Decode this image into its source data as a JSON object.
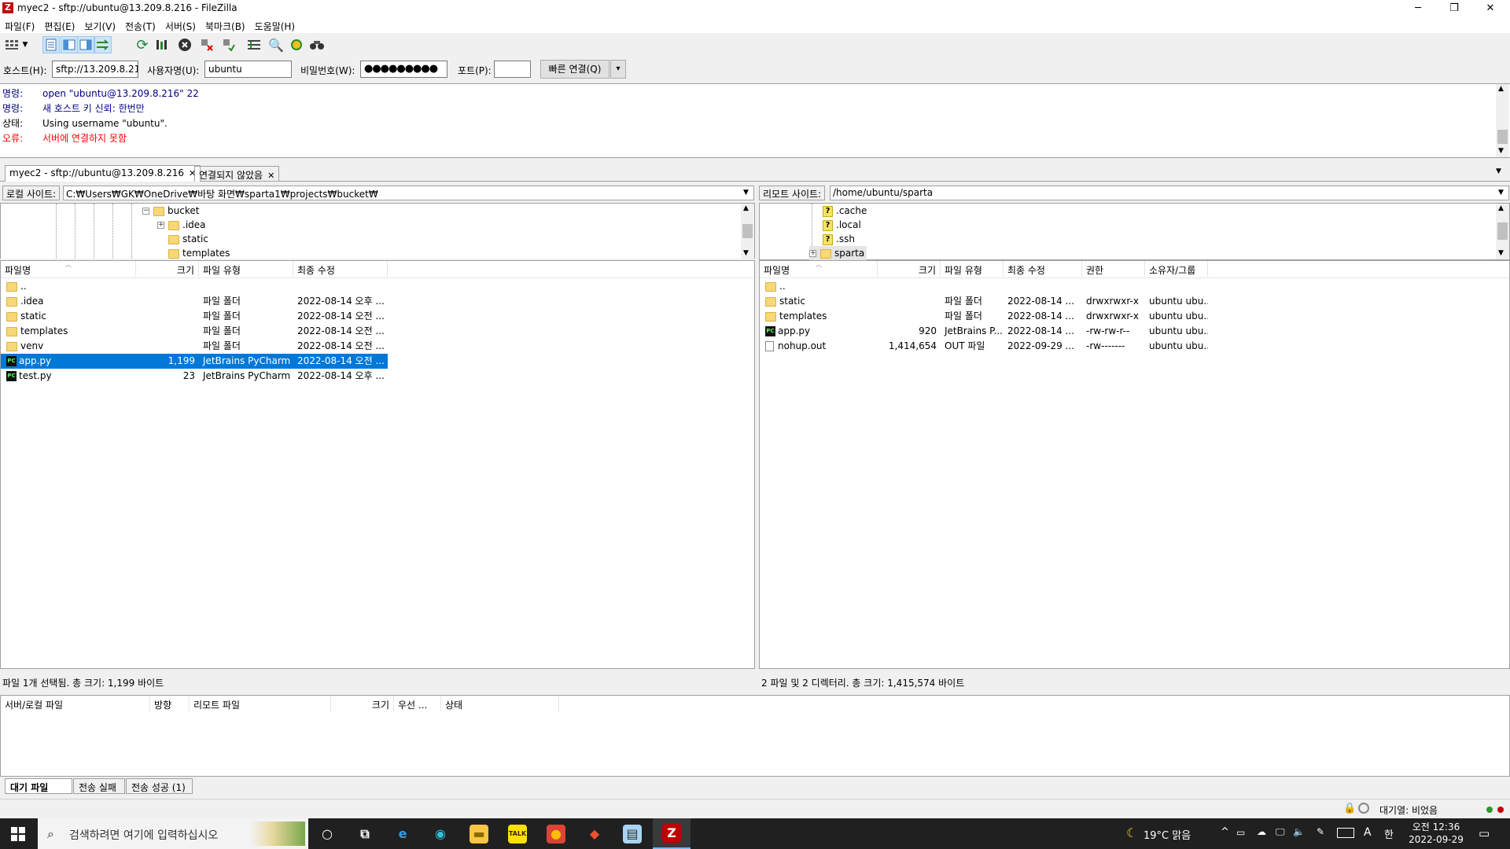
{
  "window": {
    "title": "myec2 - sftp://ubuntu@13.209.8.216 - FileZilla",
    "app_icon": "Z",
    "controls": {
      "minimize": "─",
      "maximize": "❐",
      "close": "✕"
    }
  },
  "menu": [
    "파일(F)",
    "편집(E)",
    "보기(V)",
    "전송(T)",
    "서버(S)",
    "북마크(B)",
    "도움말(H)"
  ],
  "toolbar": {
    "icons": [
      "site-manager-icon",
      "dropdown-arrow-icon",
      "toggle-log-icon",
      "toggle-local-tree-icon",
      "toggle-remote-tree-icon",
      "toggle-queue-icon",
      "refresh-icon",
      "process-queue-icon",
      "cancel-icon",
      "disconnect-icon",
      "reconnect-icon",
      "filter-icon",
      "compare-icon",
      "sync-browse-icon",
      "search-icon"
    ]
  },
  "quickconnect": {
    "host_label": "호스트(H):",
    "host_value": "sftp://13.209.8.216",
    "user_label": "사용자명(U):",
    "user_value": "ubuntu",
    "password_label": "비밀번호(W):",
    "password_value": "●●●●●●●●●",
    "port_label": "포트(P):",
    "port_value": "",
    "connect_button": "빠른 연결(Q)",
    "dropdown": "▾"
  },
  "log": [
    {
      "kind": "명령:",
      "text": "open \"ubuntu@13.209.8.216\" 22",
      "color": "#000080"
    },
    {
      "kind": "명령:",
      "text": "새 호스트 키 신뢰: 한번만",
      "color": "#000080"
    },
    {
      "kind": "상태:",
      "text": "Using username \"ubuntu\".",
      "color": "#000000"
    },
    {
      "kind": "오류:",
      "text": "서버에 연결하지 못함",
      "color": "#ff0000"
    }
  ],
  "tabs": [
    {
      "label": "myec2 - sftp://ubuntu@13.209.8.216",
      "close": "✕"
    },
    {
      "label": "연결되지 않았음",
      "close": "✕"
    }
  ],
  "local": {
    "site_label": "로컬 사이트:",
    "path": "C:₩Users₩GK₩OneDrive₩바탕 화면₩sparta1₩projects₩bucket₩",
    "tree": [
      {
        "name": "bucket",
        "expander": "−"
      },
      {
        "name": ".idea",
        "expander": "+"
      },
      {
        "name": "static",
        "expander": ""
      },
      {
        "name": "templates",
        "expander": ""
      }
    ],
    "columns": [
      "파일명",
      "크기",
      "파일 유형",
      "최종 수정"
    ],
    "files": [
      {
        "name": "..",
        "size": "",
        "type": "",
        "modified": "",
        "icon": "folder"
      },
      {
        "name": ".idea",
        "size": "",
        "type": "파일 폴더",
        "modified": "2022-08-14 오후 ...",
        "icon": "folder"
      },
      {
        "name": "static",
        "size": "",
        "type": "파일 폴더",
        "modified": "2022-08-14 오전 ...",
        "icon": "folder"
      },
      {
        "name": "templates",
        "size": "",
        "type": "파일 폴더",
        "modified": "2022-08-14 오전 ...",
        "icon": "folder"
      },
      {
        "name": "venv",
        "size": "",
        "type": "파일 폴더",
        "modified": "2022-08-14 오전 ...",
        "icon": "folder"
      },
      {
        "name": "app.py",
        "size": "1,199",
        "type": "JetBrains PyCharm",
        "modified": "2022-08-14 오전 ...",
        "icon": "pycharm",
        "selected": true
      },
      {
        "name": "test.py",
        "size": "23",
        "type": "JetBrains PyCharm",
        "modified": "2022-08-14 오후 ...",
        "icon": "pycharm"
      }
    ],
    "status": "파일 1개 선택됨. 총 크기: 1,199 바이트"
  },
  "remote": {
    "site_label": "리모트 사이트:",
    "path": "/home/ubuntu/sparta",
    "tree": [
      {
        "name": ".cache",
        "icon": "unknown"
      },
      {
        "name": ".local",
        "icon": "unknown"
      },
      {
        "name": ".ssh",
        "icon": "unknown"
      },
      {
        "name": "sparta",
        "icon": "folder",
        "expander": "+"
      }
    ],
    "columns": [
      "파일명",
      "크기",
      "파일 유형",
      "최종 수정",
      "권한",
      "소유자/그룹"
    ],
    "files": [
      {
        "name": "..",
        "size": "",
        "type": "",
        "modified": "",
        "perm": "",
        "owner": "",
        "icon": "folder"
      },
      {
        "name": "static",
        "size": "",
        "type": "파일 폴더",
        "modified": "2022-08-14 ...",
        "perm": "drwxrwxr-x",
        "owner": "ubuntu ubu...",
        "icon": "folder"
      },
      {
        "name": "templates",
        "size": "",
        "type": "파일 폴더",
        "modified": "2022-08-14 ...",
        "perm": "drwxrwxr-x",
        "owner": "ubuntu ubu...",
        "icon": "folder"
      },
      {
        "name": "app.py",
        "size": "920",
        "type": "JetBrains P...",
        "modified": "2022-08-14 ...",
        "perm": "-rw-rw-r--",
        "owner": "ubuntu ubu...",
        "icon": "pycharm"
      },
      {
        "name": "nohup.out",
        "size": "1,414,654",
        "type": "OUT 파일",
        "modified": "2022-09-29 ...",
        "perm": "-rw-------",
        "owner": "ubuntu ubu...",
        "icon": "file"
      }
    ],
    "status": "2 파일 및 2 디렉터리. 총 크기: 1,415,574 바이트"
  },
  "queue": {
    "columns": [
      "서버/로컬 파일",
      "방향",
      "리모트 파일",
      "크기",
      "우선 ...",
      "상태"
    ],
    "tabs": [
      "대기 파일",
      "전송 실패",
      "전송 성공 (1)"
    ]
  },
  "statusbar": {
    "queue": "대기열: 비었음"
  },
  "taskbar": {
    "search_placeholder": "검색하려면 여기에 입력하십시오",
    "weather": "19°C 맑음",
    "ime": "A",
    "ime2": "한",
    "time": "오전 12:36",
    "date": "2022-09-29",
    "apps": [
      {
        "name": "cortana-icon",
        "glyph": "○",
        "bg": "transparent",
        "fg": "#ffffff"
      },
      {
        "name": "task-view-icon",
        "glyph": "⧉",
        "bg": "transparent",
        "fg": "#ffffff"
      },
      {
        "name": "ie-icon",
        "glyph": "e",
        "bg": "transparent",
        "fg": "#3b9ae1"
      },
      {
        "name": "edge-icon",
        "glyph": "◉",
        "bg": "transparent",
        "fg": "#33c0e0"
      },
      {
        "name": "file-explorer-icon",
        "glyph": "▬",
        "bg": "#f8c640",
        "fg": "#8a6a00"
      },
      {
        "name": "kakaotalk-icon",
        "glyph": "TALK",
        "bg": "#fae100",
        "fg": "#3c1e1e"
      },
      {
        "name": "chrome-icon",
        "glyph": "●",
        "bg": "#db4437",
        "fg": "#fbbc05"
      },
      {
        "name": "git-icon",
        "glyph": "◆",
        "bg": "transparent",
        "fg": "#f05033"
      },
      {
        "name": "notepad-icon",
        "glyph": "▤",
        "bg": "#a8d4f0",
        "fg": "#333"
      },
      {
        "name": "filezilla-taskbar-icon",
        "glyph": "Z",
        "bg": "#bf0000",
        "fg": "#ffffff"
      }
    ]
  }
}
